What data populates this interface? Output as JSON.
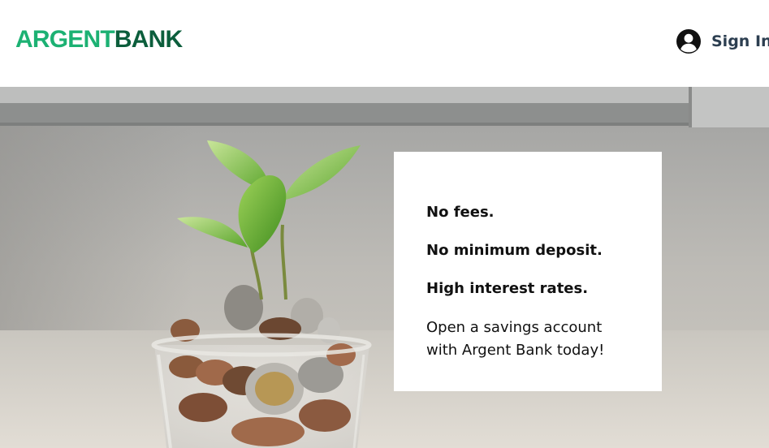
{
  "header": {
    "logo_part1": "ARGENT",
    "logo_part2": "BANK",
    "signin_label": "Sign In",
    "signin_icon": "user-circle-icon"
  },
  "hero": {
    "image": "coins-in-glass-jar-with-sprouting-plant",
    "card": {
      "line1": "No fees.",
      "line2": "No minimum deposit.",
      "line3": "High interest rates.",
      "cta": "Open a savings account with Argent Bank today!"
    }
  },
  "colors": {
    "brand_green": "#1cb173",
    "brand_dark_green": "#0c5e3c",
    "signin_text": "#2c3e50"
  }
}
